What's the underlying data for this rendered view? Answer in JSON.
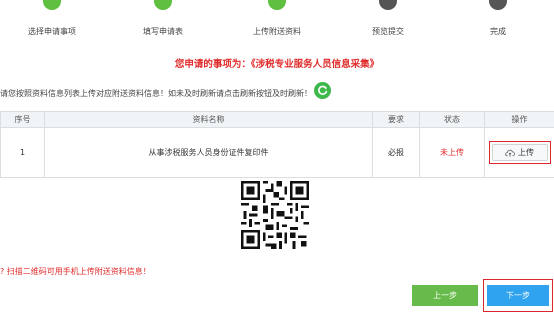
{
  "steps": [
    {
      "label": "选择申请事项",
      "state": "done"
    },
    {
      "label": "填写申请表",
      "state": "done"
    },
    {
      "label": "上传附送资料",
      "state": "done"
    },
    {
      "label": "预览提交",
      "state": "todo"
    },
    {
      "label": "完成",
      "state": "todo"
    }
  ],
  "headline": "您申请的事项为：《涉税专业服务人员信息采集》",
  "notice": "请您按照资料信息列表上传对应附送资料信息！如未及时刷新请点击刷新按钮及时刷新！",
  "table": {
    "headers": [
      "序号",
      "资料名称",
      "要求",
      "状态",
      "操作"
    ],
    "rows": [
      {
        "index": "1",
        "name": "从事涉税服务人员身份证件复印件",
        "requirement": "必报",
        "status": "未上传",
        "action": "上传"
      }
    ]
  },
  "qr_hint": "扫描二维码可用手机上传附送资料信息！",
  "buttons": {
    "prev": "上一步",
    "next": "下一步"
  },
  "colors": {
    "accent_red": "#e02c2c",
    "done_green": "#5fbf3f",
    "prev_green": "#66bb4a",
    "next_blue": "#2fa3ee"
  }
}
